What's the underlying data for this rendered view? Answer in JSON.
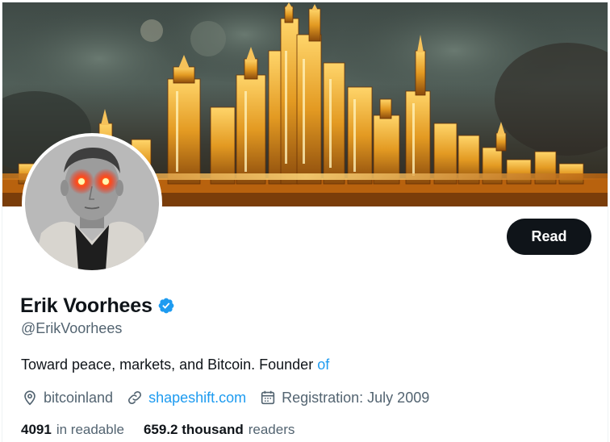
{
  "profile": {
    "display_name": "Erik Voorhees",
    "handle": "@ErikVoorhees",
    "verified": true,
    "bio_text": "Toward peace, markets, and Bitcoin. Founder ",
    "bio_link": "of",
    "location": "bitcoinland",
    "website": "shapeshift.com",
    "registration": "Registration: July 2009"
  },
  "actions": {
    "read_label": "Read"
  },
  "stats": {
    "following_count": "4091",
    "following_label": "in readable",
    "followers_count": "659.2 thousand",
    "followers_label": "readers"
  },
  "colors": {
    "accent": "#1d9bf0",
    "text": "#0f1419",
    "secondary_text": "#536471",
    "button_bg": "#0f1419"
  },
  "icons": {
    "verified": "verified-badge-icon",
    "location": "location-pin-icon",
    "website": "link-icon",
    "registration": "calendar-icon"
  }
}
